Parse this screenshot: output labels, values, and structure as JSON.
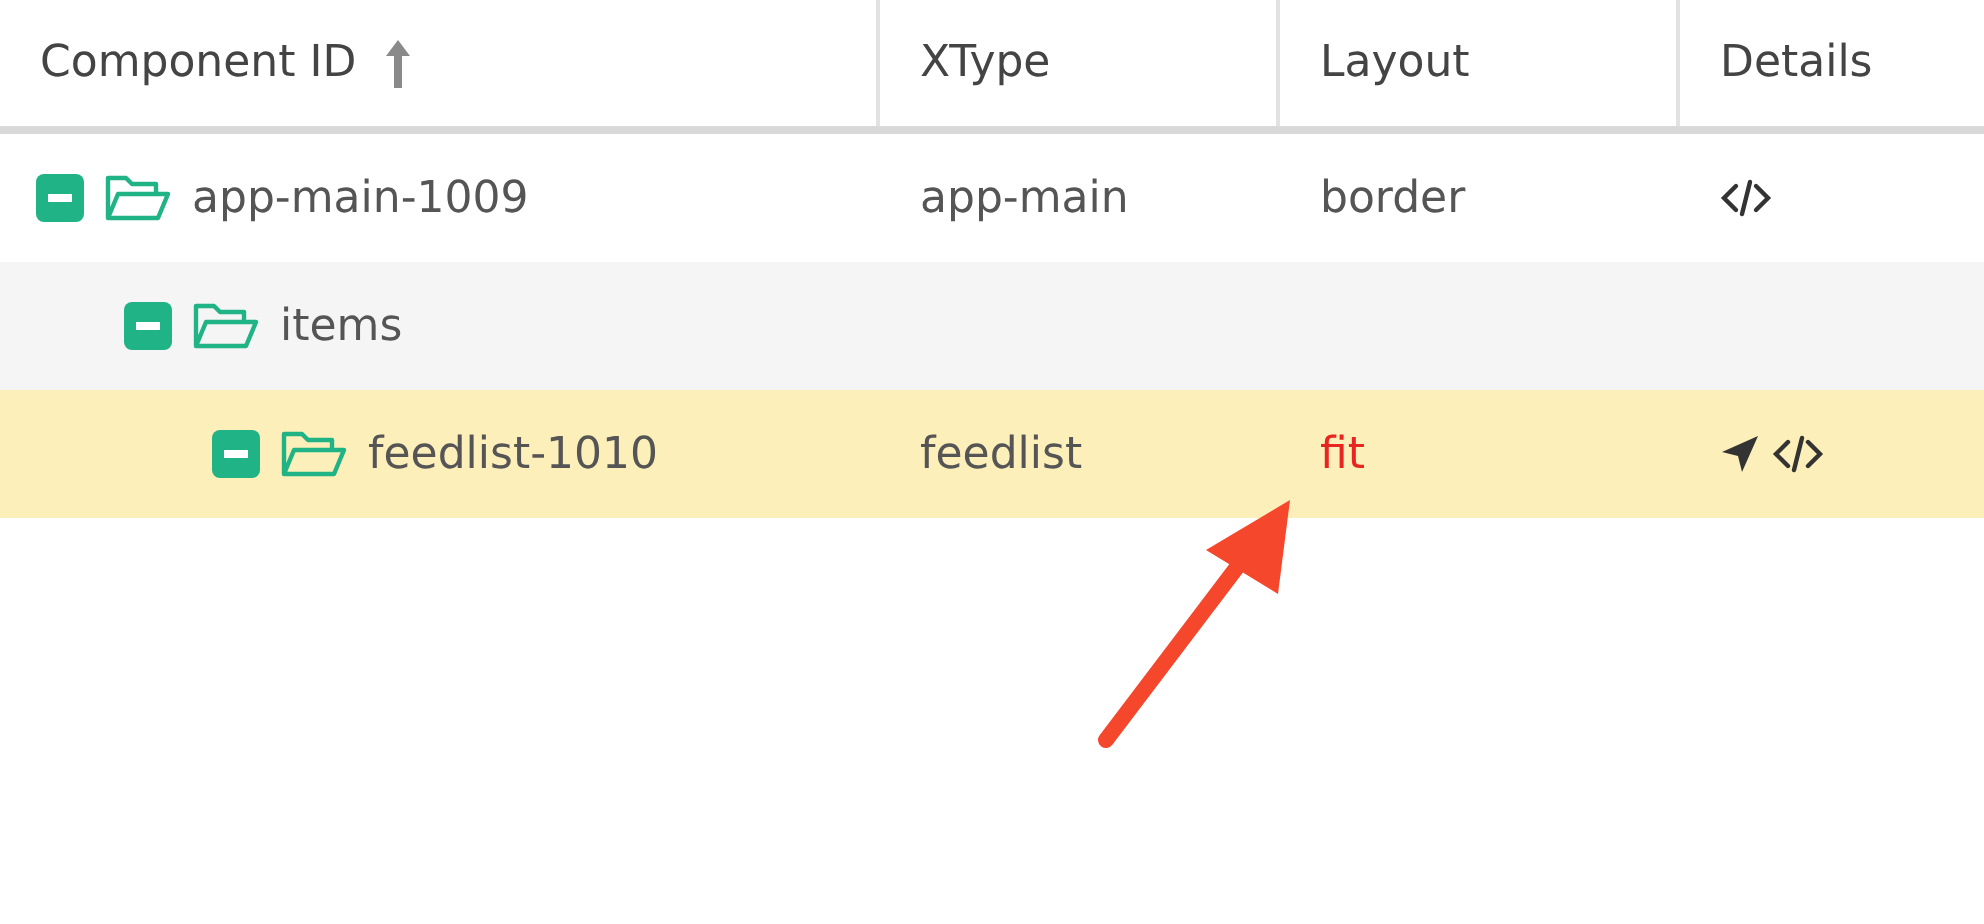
{
  "table": {
    "columns": [
      {
        "label": "Component ID",
        "sorted": true
      },
      {
        "label": "XType",
        "sorted": false
      },
      {
        "label": "Layout",
        "sorted": false
      },
      {
        "label": "Details",
        "sorted": false
      }
    ],
    "rows": [
      {
        "id": "app-main-1009",
        "xtype": "app-main",
        "layout": "border",
        "layout_flagged": false,
        "locate": false,
        "expanded": true,
        "selected": false,
        "children": [
          {
            "id": "items",
            "expanded": true,
            "selected": false,
            "children": [
              {
                "id": "feedlist-1010",
                "xtype": "feedlist",
                "layout": "fit",
                "layout_flagged": true,
                "locate": true,
                "expanded": true,
                "selected": true
              }
            ]
          }
        ]
      }
    ]
  }
}
